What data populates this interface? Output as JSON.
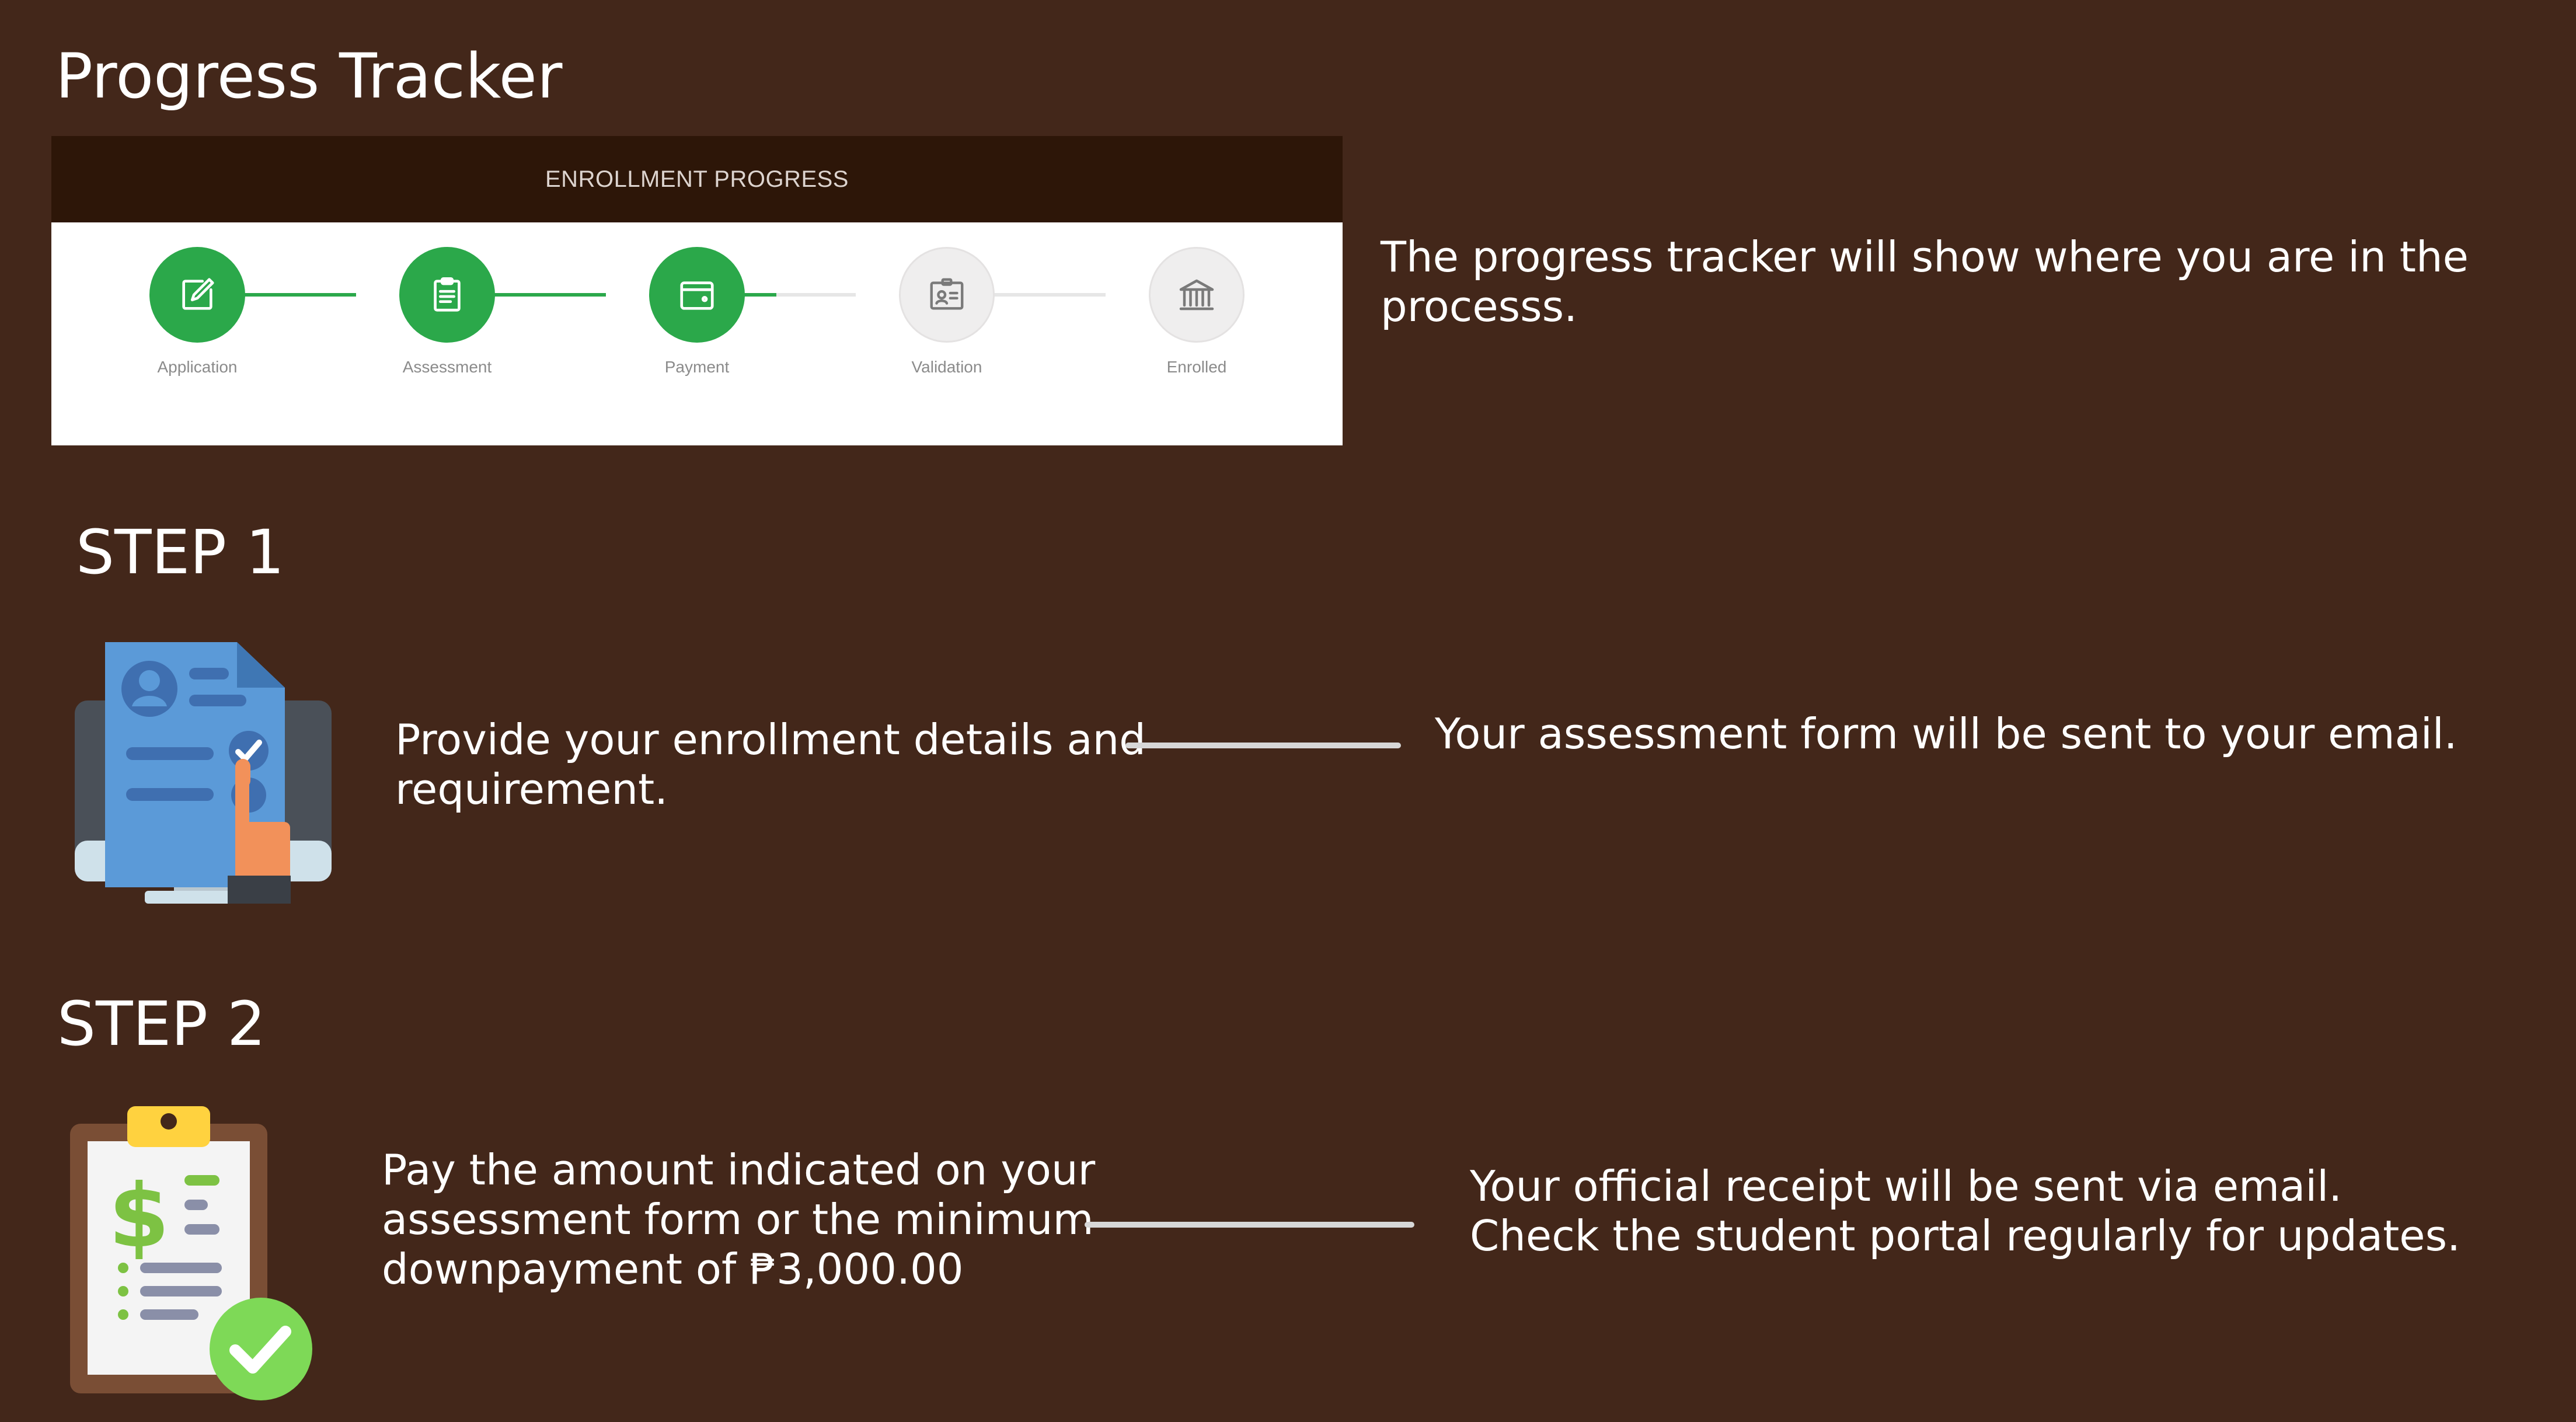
{
  "page": {
    "title": "Progress Tracker"
  },
  "tracker": {
    "header": "ENROLLMENT PROGRESS",
    "steps": [
      {
        "label": "Application",
        "icon": "edit-icon",
        "completed": true
      },
      {
        "label": "Assessment",
        "icon": "clipboard-icon",
        "completed": true
      },
      {
        "label": "Payment",
        "icon": "wallet-icon",
        "completed": true
      },
      {
        "label": "Validation",
        "icon": "id-card-icon",
        "completed": false
      },
      {
        "label": "Enrolled",
        "icon": "bank-icon",
        "completed": false
      }
    ],
    "description": "The progress tracker will show where you are in the processs."
  },
  "step1": {
    "heading": "STEP 1",
    "icon": "computer-checklist-icon",
    "action": "Provide your enrollment details and requirement.",
    "result": "Your assessment form will be sent to your email."
  },
  "step2": {
    "heading": "STEP 2",
    "icon": "payment-clipboard-icon",
    "action": "Pay the amount indicated on your assessment form or the minimum downpayment of ₱3,000.00",
    "result": "Your official receipt will be sent via email. Check the student portal regularly for updates."
  },
  "colors": {
    "background": "#43271a",
    "tracker_header": "#2d1608",
    "complete_green": "#2ba84a",
    "pending_gray": "#efeeee"
  }
}
